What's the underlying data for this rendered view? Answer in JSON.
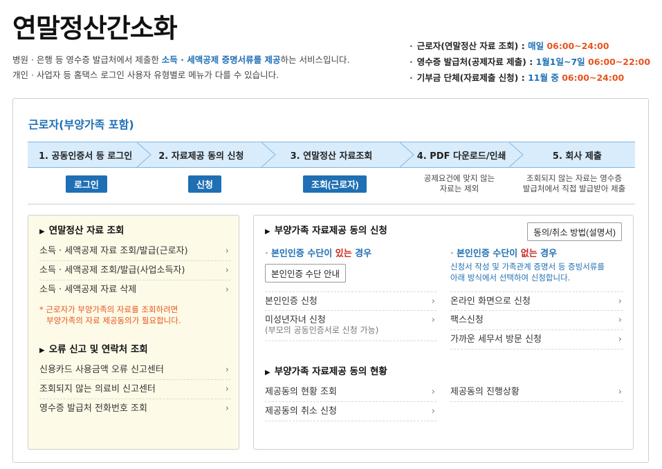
{
  "header": {
    "title": "연말정산간소화",
    "intro_line1_pre": "병원 · 은행 등 영수증 발급처에서 제출한 ",
    "intro_line1_hl": "소득 · 세액공제 증명서류를 제공",
    "intro_line1_post": "하는 서비스입니다.",
    "intro_line2": "개인 · 사업자 등 홈택스 로그인 사용자 유형별로 메뉴가 다를 수 있습니다."
  },
  "hours": [
    {
      "label": "근로자(연말정산 자료 조회) : ",
      "period": "매일 ",
      "time": "06:00~24:00"
    },
    {
      "label": "영수증 발급처(공제자료 제출) : ",
      "period": "1월1일~7일 ",
      "time": "06:00~22:00"
    },
    {
      "label": "기부금 단체(자료제출 신청) : ",
      "period": "11월 중 ",
      "time": "06:00~24:00"
    }
  ],
  "section": {
    "title": "근로자(부양가족 포함)"
  },
  "steps": [
    {
      "label": "1. 공동인증서 등 로그인"
    },
    {
      "label": "2. 자료제공 동의 신청"
    },
    {
      "label": "3. 연말정산 자료조회"
    },
    {
      "label": "4. PDF 다운로드/인쇄"
    },
    {
      "label": "5. 회사 제출"
    }
  ],
  "step_actions": {
    "login_button": "로그인",
    "apply_button": "신청",
    "lookup_button": "조회(근로자)",
    "note4_line1": "공제요건에 맞지 않는",
    "note4_line2": "자료는 제외",
    "note5_line1": "조회되지 않는 자료는 영수증",
    "note5_line2": "발급처에서 직접 발급받아 제출"
  },
  "left_panel": {
    "group1_title": "연말정산 자료 조회",
    "group1_items": [
      "소득 · 세액공제 자료 조회/발급(근로자)",
      "소득 · 세액공제 조회/발급(사업소득자)",
      "소득 · 세액공제 자료 삭제"
    ],
    "warning_line1": "* 근로자가 부양가족의 자료를 조회하려면",
    "warning_line2": "부양가족의 자료 제공동의가 필요합니다.",
    "group2_title": "오류 신고 및 연락처 조회",
    "group2_items": [
      "신용카드 사용금액 오류 신고센터",
      "조회되지 않는 의료비 신고센터",
      "영수증 발급처 전화번호 조회"
    ]
  },
  "right_panel": {
    "group1_title": "부양가족 자료제공 동의 신청",
    "guide_button": "동의/취소 방법(설명서)",
    "cond_yes_pre": "본인인증 수단이 ",
    "cond_yes_hl": "있는",
    "cond_yes_post": " 경우",
    "auth_guide_button": "본인인증 수단 안내",
    "cond_no_pre": "본인인증 수단이 ",
    "cond_no_hl": "없는",
    "cond_no_post": " 경우",
    "cond_no_desc1": "신청서 작성 및 가족관계 증명서 등 증빙서류를",
    "cond_no_desc2": "아래 방식에서 선택하여 신청합니다.",
    "yes_items": [
      "본인인증 신청",
      "미성년자녀 신청"
    ],
    "yes_sub_note": "(부모의 공동인증서로 신청 가능)",
    "no_items": [
      "온라인 화면으로 신청",
      "팩스신청",
      "가까운 세무서 방문 신청"
    ],
    "group2_title": "부양가족 자료제공 동의 현황",
    "status_left": [
      "제공동의 현황 조회",
      "제공동의 취소 신청"
    ],
    "status_right": [
      "제공동의 진행상황"
    ]
  },
  "icons": {
    "arrow": "chevron-right-icon",
    "bullet": "triangle-right-icon"
  },
  "colors": {
    "accent_blue": "#1f6fb5",
    "accent_orange": "#e8541c",
    "accent_red": "#c8281f",
    "step_bg": "#d9ecfb",
    "panel_yellow": "#fdfbe8"
  }
}
